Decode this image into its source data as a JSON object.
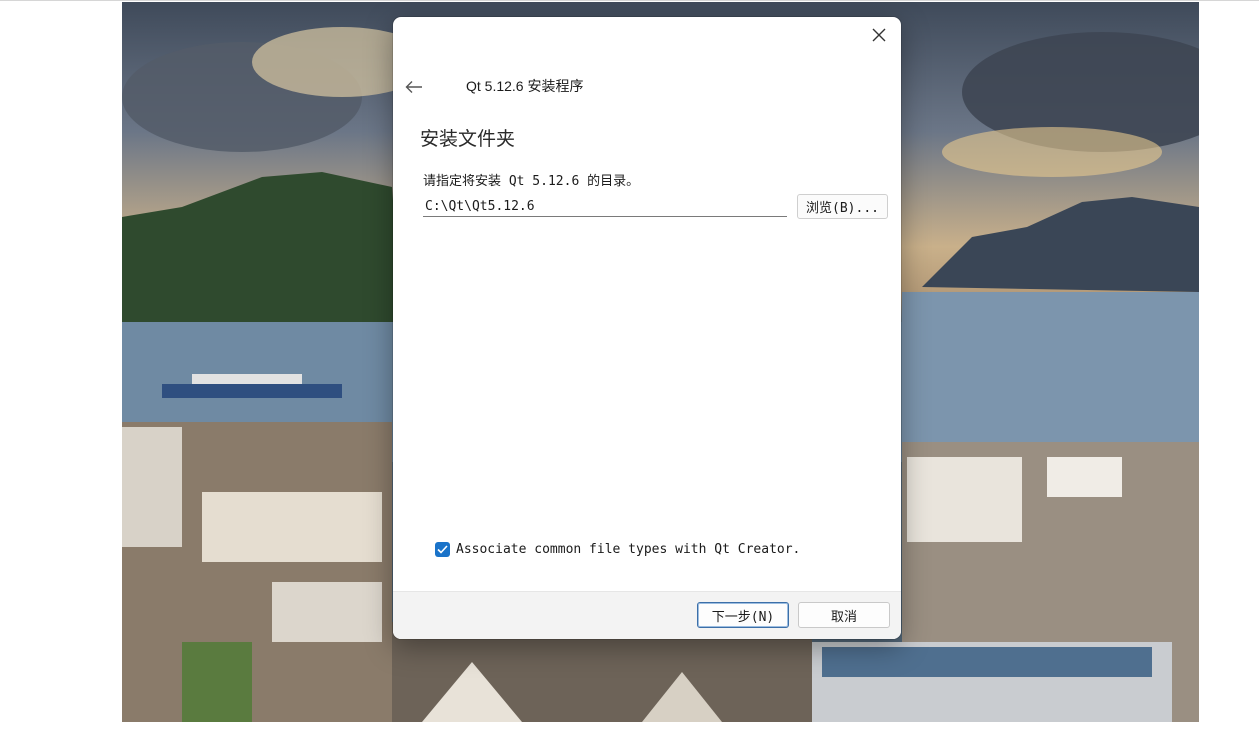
{
  "window": {
    "app_title": "Qt 5.12.6 安装程序",
    "page_heading": "安装文件夹",
    "prompt": "请指定将安装 Qt 5.12.6 的目录。",
    "install_path": "C:\\Qt\\Qt5.12.6",
    "browse_label": "浏览(B)...",
    "associate_label": "Associate common file types with Qt Creator.",
    "associate_checked": true,
    "next_label": "下一步(N)",
    "cancel_label": "取消"
  },
  "icons": {
    "close": "close-icon",
    "back": "back-arrow-icon",
    "check": "checkmark-icon"
  },
  "colors": {
    "accent": "#1a73c9",
    "footer_bg": "#f3f3f3"
  }
}
